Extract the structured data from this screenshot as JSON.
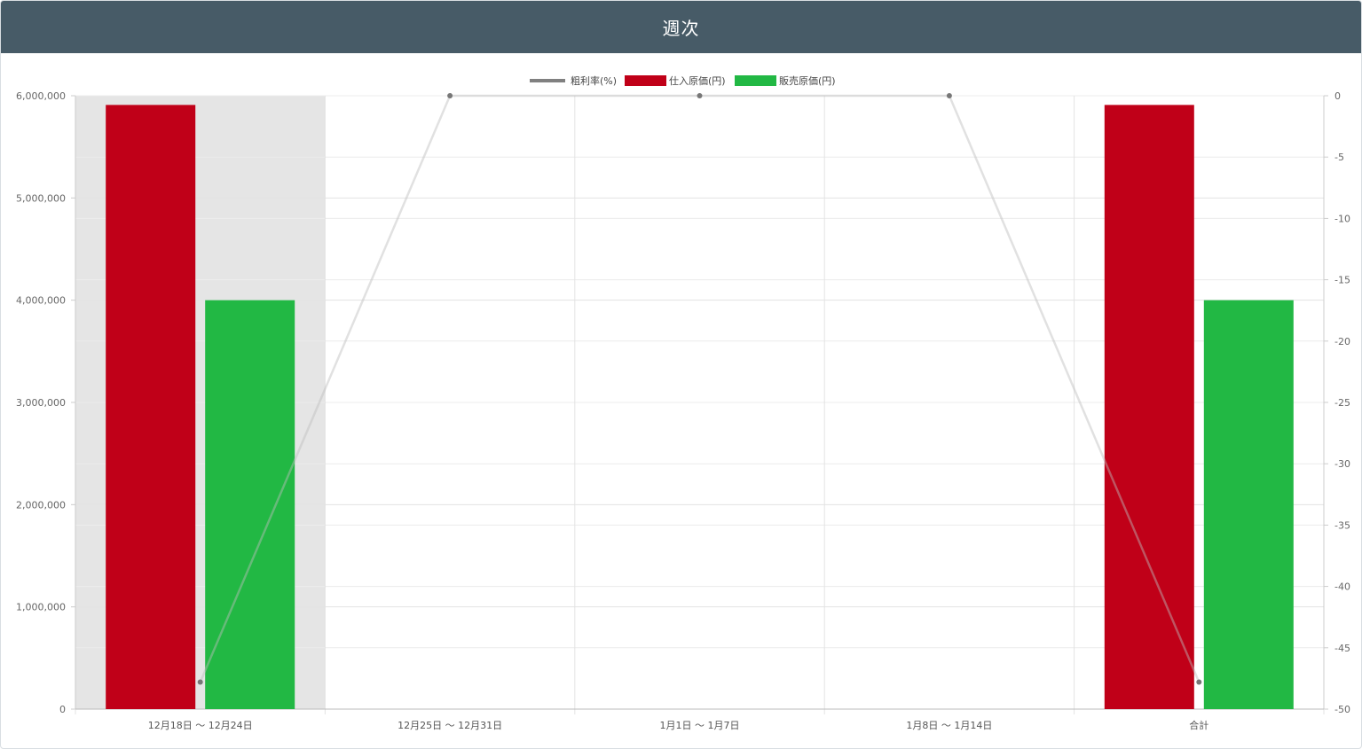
{
  "panel": {
    "title": "週次"
  },
  "colors": {
    "header_bg": "#475b67",
    "purchase": "#c00018",
    "sales": "#22b844",
    "margin_line": "#bdbdbd",
    "margin_point": "#777777",
    "highlight": "#e5e5e5"
  },
  "chart_data": {
    "type": "bar",
    "categories": [
      "12月18日 ～ 12月24日",
      "12月25日 ～ 12月31日",
      "1月1日 ～ 1月7日",
      "1月8日 ～ 1月14日",
      "合計"
    ],
    "series": [
      {
        "name": "仕入原価(円)",
        "type": "bar",
        "axis": "left",
        "color": "#c00018",
        "values": [
          5910000,
          0,
          0,
          0,
          5910000
        ]
      },
      {
        "name": "販売原価(円)",
        "type": "bar",
        "axis": "right_none",
        "color": "#22b844",
        "values": [
          4000000,
          0,
          0,
          0,
          4000000
        ]
      },
      {
        "name": "粗利率(%)",
        "type": "line",
        "axis": "right",
        "color": "#bdbdbd",
        "values": [
          -47.8,
          0,
          0,
          0,
          -47.8
        ]
      }
    ],
    "legend": {
      "position": "top-center",
      "order": [
        "粗利率(%)",
        "仕入原価(円)",
        "販売原価(円)"
      ]
    },
    "left_axis": {
      "ylim": [
        0,
        6000000
      ],
      "ticks": [
        "0",
        "1,000,000",
        "2,000,000",
        "3,000,000",
        "4,000,000",
        "5,000,000",
        "6,000,000"
      ]
    },
    "right_axis": {
      "ylim": [
        -50,
        0
      ],
      "ticks": [
        "0",
        "-5",
        "-10",
        "-15",
        "-20",
        "-25",
        "-30",
        "-35",
        "-40",
        "-45",
        "-50"
      ]
    },
    "highlighted_category": "12月18日 ～ 12月24日",
    "grid": true
  }
}
